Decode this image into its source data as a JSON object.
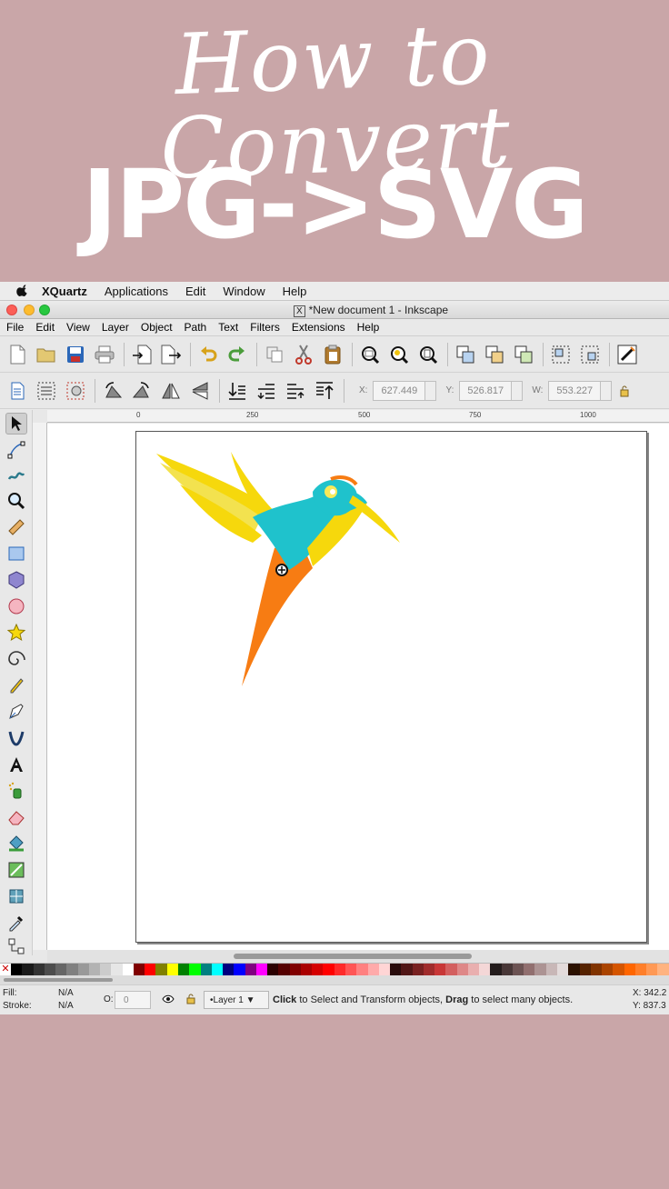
{
  "hero": {
    "script_title": "How to Convert",
    "bold_title": "JPG->SVG"
  },
  "menubar": {
    "app_name": "XQuartz",
    "items": [
      "Applications",
      "Edit",
      "Window",
      "Help"
    ]
  },
  "window": {
    "x_glyph": "X",
    "title": "*New document 1 - Inkscape"
  },
  "app_menu": {
    "items": [
      "File",
      "Edit",
      "View",
      "Layer",
      "Object",
      "Path",
      "Text",
      "Filters",
      "Extensions",
      "Help"
    ]
  },
  "coords": {
    "x_label": "X:",
    "x_value": "627.449",
    "y_label": "Y:",
    "y_value": "526.817",
    "w_label": "W:",
    "w_value": "553.227"
  },
  "ruler": {
    "h_labels": [
      "0",
      "250",
      "500",
      "750",
      "1000"
    ]
  },
  "colors": {
    "background": "#c9a6a8",
    "bird_teal": "#1fc2cc",
    "bird_yellow": "#f6d80c",
    "bird_orange": "#f77c13"
  },
  "palette": [
    "#000000",
    "#1a1a1a",
    "#333333",
    "#4d4d4d",
    "#666666",
    "#808080",
    "#999999",
    "#b3b3b3",
    "#cccccc",
    "#e6e6e6",
    "#ffffff",
    "#800000",
    "#ff0000",
    "#808000",
    "#ffff00",
    "#008000",
    "#00ff00",
    "#008080",
    "#00ffff",
    "#000080",
    "#0000ff",
    "#800080",
    "#ff00ff",
    "#2b0000",
    "#550000",
    "#800000",
    "#aa0000",
    "#d40000",
    "#ff0000",
    "#ff2a2a",
    "#ff5555",
    "#ff8080",
    "#ffaaaa",
    "#ffd5d5",
    "#280b0b",
    "#501616",
    "#782121",
    "#a02c2c",
    "#c83737",
    "#d35f5f",
    "#de8787",
    "#e9afaf",
    "#f4d7d7",
    "#241c1c",
    "#483737",
    "#6c5353",
    "#916f6f",
    "#ac9393",
    "#c8b7b7",
    "#e3dbdb",
    "#2b1100",
    "#552200",
    "#803300",
    "#aa4400",
    "#d45500",
    "#ff6600",
    "#ff7f2a",
    "#ff9955",
    "#ffb380"
  ],
  "status": {
    "fill_label": "Fill:",
    "fill_value": "N/A",
    "stroke_label": "Stroke:",
    "stroke_value": "N/A",
    "opacity_label": "O:",
    "opacity_value": "0",
    "layer": "•Layer 1",
    "message_click": "Click",
    "message_mid": " to Select and Transform objects, ",
    "message_drag": "Drag",
    "message_end": " to select many objects.",
    "x_readout": "X:   342.2",
    "y_readout": "Y:   837.3"
  }
}
